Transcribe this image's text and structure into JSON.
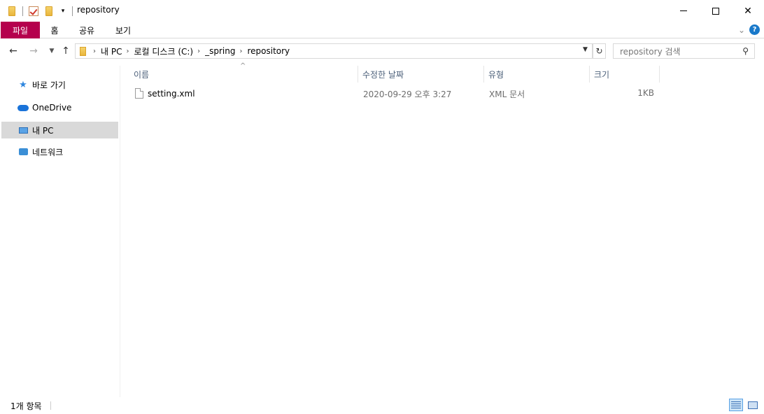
{
  "window": {
    "title": "repository",
    "controls": {
      "minimize": "minimize",
      "maximize": "maximize",
      "close": "✕"
    }
  },
  "ribbon": {
    "tabs": [
      {
        "label": "파일",
        "active": true,
        "color": "#b5004d"
      },
      {
        "label": "홈"
      },
      {
        "label": "공유"
      },
      {
        "label": "보기"
      }
    ],
    "expand_icon": "chevron-down-icon",
    "help_label": "?"
  },
  "address": {
    "crumbs": [
      "내 PC",
      "로컬 디스크 (C:)",
      "_spring",
      "repository"
    ]
  },
  "search": {
    "placeholder": "repository 검색"
  },
  "sidebar": {
    "items": [
      {
        "label": "바로 가기",
        "icon": "star-icon"
      },
      {
        "label": "OneDrive",
        "icon": "cloud-icon"
      },
      {
        "label": "내 PC",
        "icon": "computer-icon",
        "selected": true
      },
      {
        "label": "네트워크",
        "icon": "network-icon"
      }
    ]
  },
  "columns": {
    "name": "이름",
    "date": "수정한 날짜",
    "type": "유형",
    "size": "크기"
  },
  "files": [
    {
      "name": "setting.xml",
      "modified": "2020-09-29 오후 3:27",
      "type": "XML 문서",
      "size": "1KB"
    }
  ],
  "status": {
    "count": "1개 항목"
  }
}
